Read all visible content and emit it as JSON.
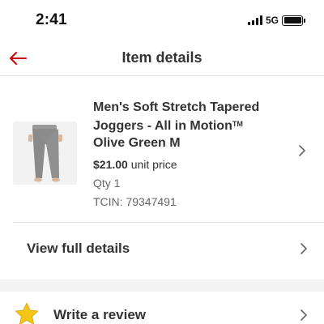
{
  "status_bar": {
    "time": "2:41",
    "network": "5G",
    "battery_level": 1.0
  },
  "nav": {
    "back_icon": "back-arrow-icon",
    "title": "Item details",
    "accent_color": "#cc0000"
  },
  "item": {
    "title_main": "Men's Soft Stretch Tapered Joggers - All in Motion",
    "trademark": "TM",
    "title_variant": "Olive Green M",
    "price": "$21.00",
    "price_suffix": "unit price",
    "qty": "Qty 1",
    "tcin": "TCIN: 79347491"
  },
  "actions": {
    "view_details": "View full details",
    "write_review": "Write a review",
    "review_icon": "star-icon",
    "star_color": "#f5c518"
  }
}
